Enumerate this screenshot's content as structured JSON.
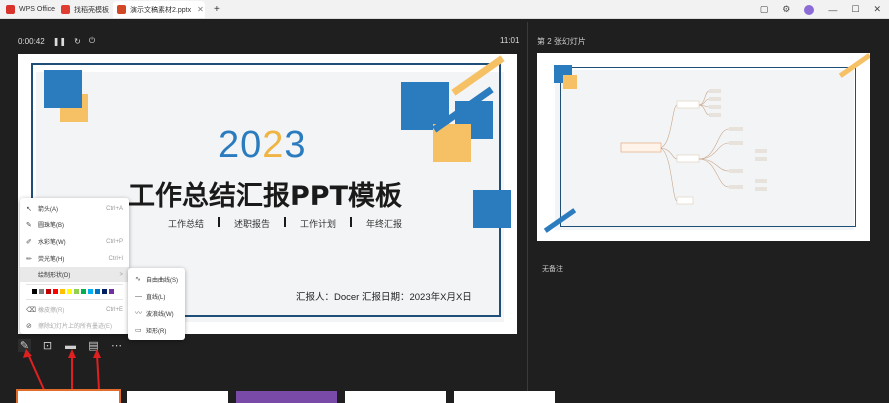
{
  "titlebar": {
    "tabs": [
      {
        "label": "WPS Office",
        "icon": "wps-logo-icon",
        "color": "#d9342b"
      },
      {
        "label": "找稻壳模板",
        "icon": "daoke-icon",
        "color": "#e03c31"
      },
      {
        "label": "演示文稿素材2.pptx",
        "icon": "ppt-icon",
        "color": "#d24726"
      }
    ],
    "new_tab": "+"
  },
  "presenter": {
    "elapsed": "0:00:42",
    "clock": "11:01",
    "next_label": "第 2 张幻灯片",
    "notes": "无备注"
  },
  "slide": {
    "year_a": "20",
    "year_b": "2",
    "year_c": "3",
    "title": "工作总结汇报PPT模板",
    "subtitles": [
      "工作总结",
      "述职报告",
      "工作计划",
      "年终汇报"
    ],
    "reporter": "汇报人：Docer   汇报日期：2023年X月X日",
    "colors": {
      "blue": "#2b7bbf",
      "gold": "#f6c064",
      "navy": "#1f4e79"
    }
  },
  "menu": {
    "items": [
      {
        "label": "箭头(A)",
        "shortcut": "Ctrl+A",
        "icon": "arrow-pointer-icon"
      },
      {
        "label": "圆珠笔(B)",
        "shortcut": "",
        "icon": "ballpoint-pen-icon"
      },
      {
        "label": "水彩笔(W)",
        "shortcut": "Ctrl+P",
        "icon": "watercolor-pen-icon"
      },
      {
        "label": "荧光笔(H)",
        "shortcut": "Ctrl+I",
        "icon": "highlighter-icon"
      },
      {
        "label": "绘制形状(D)",
        "shortcut": ">",
        "icon": "shape-icon"
      },
      {
        "label": "橡皮擦(R)",
        "shortcut": "Ctrl+E",
        "icon": "eraser-icon"
      },
      {
        "label": "擦除幻灯片上的所有墨迹(E)",
        "shortcut": "",
        "icon": "erase-all-icon"
      }
    ],
    "swatches": [
      "#000000",
      "#7f7f7f",
      "#c00000",
      "#ff0000",
      "#ffc000",
      "#ffff00",
      "#92d050",
      "#00b050",
      "#00b0f0",
      "#0070c0",
      "#002060",
      "#7030a0"
    ]
  },
  "submenu": {
    "items": [
      {
        "label": "自由曲线(S)",
        "icon": "freeform-icon"
      },
      {
        "label": "直线(L)",
        "icon": "line-icon"
      },
      {
        "label": "波浪线(W)",
        "icon": "wave-line-icon"
      },
      {
        "label": "矩形(R)",
        "icon": "rectangle-icon"
      }
    ]
  },
  "mindmap": {
    "root": "演示幻灯片演示稿",
    "branches": [
      "应用情况幻灯片",
      "显示幻灯片",
      "显示组件"
    ]
  }
}
